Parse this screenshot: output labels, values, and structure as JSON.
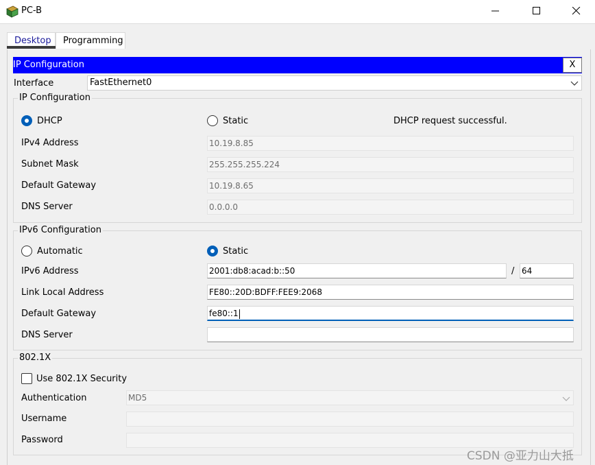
{
  "window": {
    "title": "PC-B"
  },
  "tabs": [
    {
      "label": "Desktop"
    },
    {
      "label": "Programming"
    }
  ],
  "header": {
    "title": "IP Configuration",
    "close_label": "X",
    "color": "#0000ff"
  },
  "interface": {
    "label": "Interface",
    "value": "FastEthernet0"
  },
  "ipv4": {
    "legend": "IP Configuration",
    "dhcp_label": "DHCP",
    "static_label": "Static",
    "selected": "DHCP",
    "status": "DHCP request successful.",
    "ipv4_address_label": "IPv4 Address",
    "ipv4_address": "10.19.8.85",
    "subnet_mask_label": "Subnet Mask",
    "subnet_mask": "255.255.255.224",
    "gateway_label": "Default Gateway",
    "gateway": "10.19.8.65",
    "dns_label": "DNS Server",
    "dns": "0.0.0.0"
  },
  "ipv6": {
    "legend": "IPv6 Configuration",
    "automatic_label": "Automatic",
    "static_label": "Static",
    "selected": "Static",
    "address_label": "IPv6 Address",
    "address": "2001:db8:acad:b::50",
    "prefix_separator": "/",
    "prefix": "64",
    "link_local_label": "Link Local Address",
    "link_local": "FE80::20D:BDFF:FEE9:2068",
    "gateway_label": "Default Gateway",
    "gateway": "fe80::1",
    "dns_label": "DNS Server",
    "dns": ""
  },
  "dot1x": {
    "legend": "802.1X",
    "use_security_label": "Use 802.1X Security",
    "auth_label": "Authentication",
    "auth_value": "MD5",
    "username_label": "Username",
    "username": "",
    "password_label": "Password",
    "password": ""
  },
  "watermark": "CSDN @亚力山大抵",
  "colors": {
    "accent": "#005fb8"
  }
}
